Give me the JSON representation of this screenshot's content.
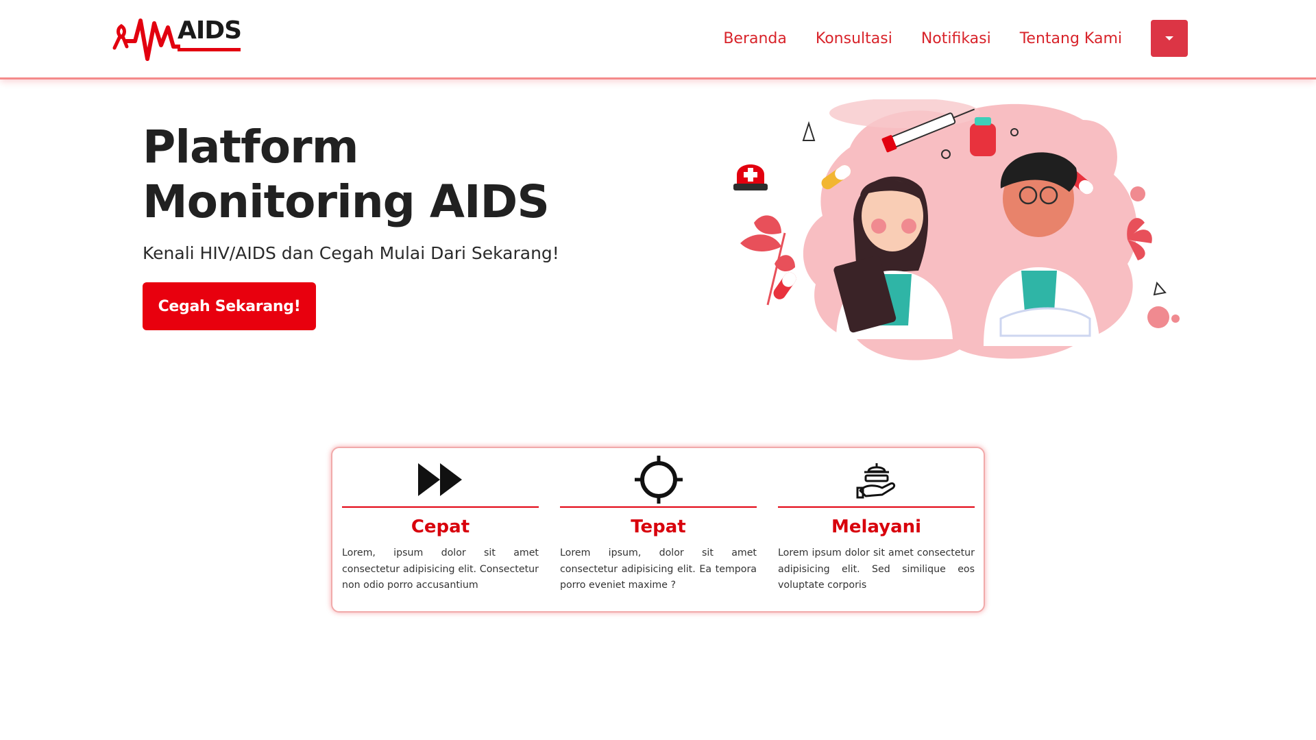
{
  "brand": {
    "logo_text": "AIDS",
    "accent": "#e2000f"
  },
  "nav": {
    "links": [
      "Beranda",
      "Konsultasi",
      "Notifikasi",
      "Tentang Kami"
    ],
    "dropdown_icon": "caret-down-icon",
    "link_color": "#d8232a",
    "dropdown_color": "#dc3545"
  },
  "hero": {
    "title_line1": "Platform",
    "title_line2": "Monitoring AIDS",
    "subtitle": "Kenali HIV/AIDS dan Cegah Mulai Dari Sekarang!",
    "cta_label": "Cegah Sekarang!",
    "cta_color": "#e8000e",
    "illustration": "doctors-illustration"
  },
  "features": [
    {
      "icon": "fast-forward-icon",
      "title": "Cepat",
      "body": "Lorem, ipsum dolor sit amet consectetur adipisicing elit. Consectetur non odio porro accusantium"
    },
    {
      "icon": "crosshair-icon",
      "title": "Tepat",
      "body": "Lorem ipsum, dolor sit amet consectetur adipisicing elit. Ea tempora porro eveniet maxime ?"
    },
    {
      "icon": "service-hand-icon",
      "title": "Melayani",
      "body": "Lorem ipsum dolor sit amet consectetur adipisicing elit. Sed similique eos voluptate corporis"
    }
  ]
}
